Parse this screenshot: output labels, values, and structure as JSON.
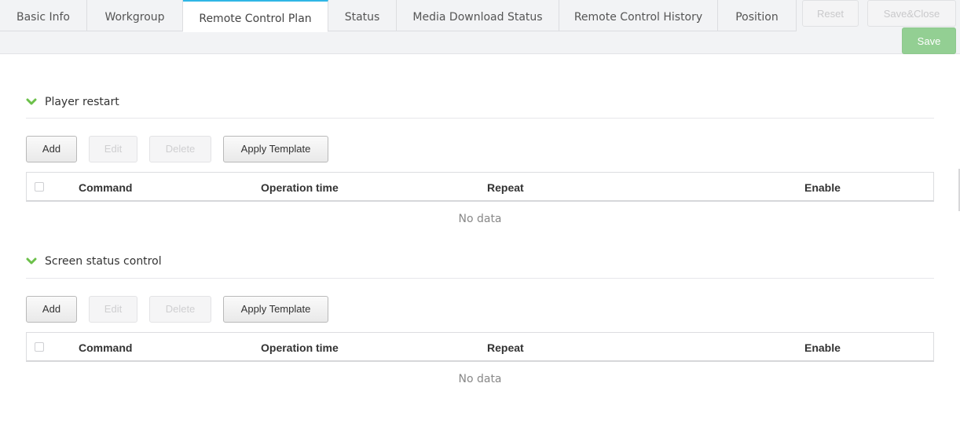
{
  "tabs": [
    {
      "label": "Basic Info",
      "active": false
    },
    {
      "label": "Workgroup",
      "active": false
    },
    {
      "label": "Remote Control Plan",
      "active": true
    },
    {
      "label": "Status",
      "active": false
    },
    {
      "label": "Media Download Status",
      "active": false
    },
    {
      "label": "Remote Control History",
      "active": false
    },
    {
      "label": "Position",
      "active": false
    }
  ],
  "toolbar": {
    "reset_label": "Reset",
    "save_close_label": "Save&Close",
    "save_label": "Save"
  },
  "sections": [
    {
      "title": "Player restart",
      "buttons": {
        "add": "Add",
        "edit": "Edit",
        "delete": "Delete",
        "apply_template": "Apply Template"
      },
      "columns": [
        "Command",
        "Operation time",
        "Repeat",
        "Enable"
      ],
      "empty_text": "No data"
    },
    {
      "title": "Screen status control",
      "buttons": {
        "add": "Add",
        "edit": "Edit",
        "delete": "Delete",
        "apply_template": "Apply Template"
      },
      "columns": [
        "Command",
        "Operation time",
        "Repeat",
        "Enable"
      ],
      "empty_text": "No data"
    }
  ],
  "colors": {
    "active_tab_accent": "#2fb6e5",
    "chevron": "#6cc04a",
    "save_button": "#93cf93"
  }
}
